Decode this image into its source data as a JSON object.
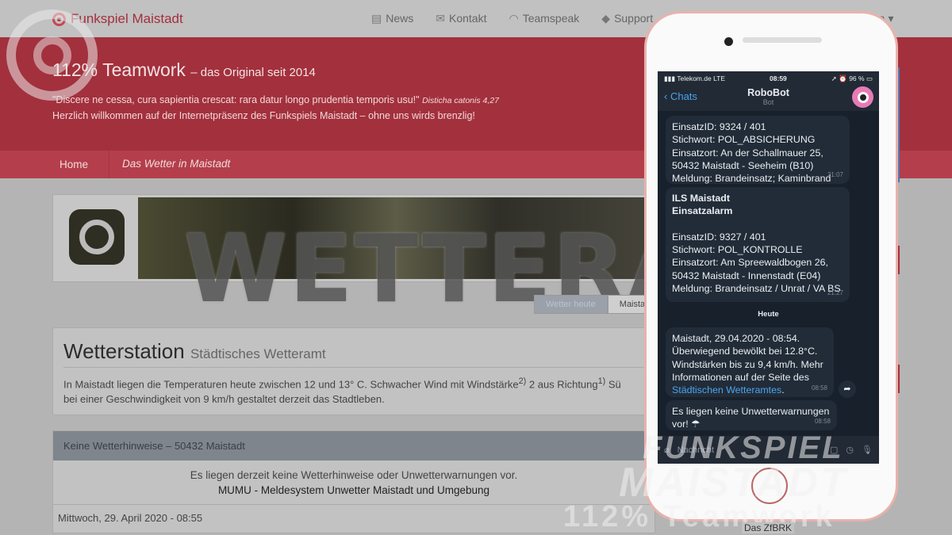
{
  "nav": {
    "brand": "Funkspiel Maistadt",
    "items": [
      {
        "icon": "newspaper-icon",
        "glyph": "▤",
        "label": "News"
      },
      {
        "icon": "envelope-icon",
        "glyph": "✉",
        "label": "Kontakt"
      },
      {
        "icon": "headset-icon",
        "glyph": "◠",
        "label": "Teamspeak"
      },
      {
        "icon": "ticket-icon",
        "glyph": "◆",
        "label": "Support"
      }
    ],
    "more": "ea ▾"
  },
  "hero": {
    "title": "112% Teamwork",
    "subtitle": "– das Original seit 2014",
    "quote": "\"Discere ne cessa, cura sapientia crescat: rara datur longo prudentia temporis usu!\"",
    "quote_source": "Disticha catonis 4,27",
    "welcome": "Herzlich willkommen auf der Internetpräsenz des Funkspiels Maistadt – ohne uns wirds brenzlig!"
  },
  "breadcrumb": {
    "home": "Home",
    "current": "Das Wetter in Maistadt"
  },
  "banner": {
    "watermark": "WETTERAMT",
    "tabs": [
      "Wetter heute",
      "Maistadt"
    ]
  },
  "station": {
    "title": "Wetterstation",
    "subtitle": "Städtisches Wetteramt",
    "text1": "In Maistadt liegen die Temperaturen heute zwischen 12 und 13° C. Schwacher Wind mit Windstärke",
    "sup1": "2)",
    "text2": " 2 aus Richtung",
    "sup2": "1)",
    "text3": " Sü",
    "text4": "bei einer Geschwindigkeit von 9 km/h gestaltet derzeit das Stadtleben."
  },
  "warnings": {
    "header": "Keine Wetterhinweise – 50432 Maistadt",
    "line1": "Es liegen derzeit keine Wetterhinweise oder Unwetterwarnungen vor.",
    "line2": "MUMU - Meldesystem Unwetter Maistadt und Umgebung",
    "footer": "Mittwoch, 29. April 2020 - 08:55"
  },
  "sidebar": {
    "zfbrk": "Das ZfBRK"
  },
  "watermark": {
    "line1": "FUNKSPIEL",
    "line2": "MAISTADT",
    "line3": "112% Teamwork"
  },
  "phone": {
    "carrier": "▮▮▮ Telekom.de  LTE",
    "time": "08:59",
    "battery": "➚ ⏰ 96 % ▭",
    "back": "Chats",
    "chat_title": "RoboBot",
    "chat_subtitle": "Bot",
    "day_separator": "Heute",
    "input_placeholder": "Nachricht",
    "messages": [
      {
        "lines": [
          "EinsatzID: 9324 / 401",
          "Stichwort: POL_ABSICHERUNG",
          "Einsatzort: An der Schallmauer 25,",
          "50432 Maistadt - Seeheim (B10)",
          "Meldung: Brandeinsatz; Kaminbrand"
        ],
        "time": "21:07"
      },
      {
        "lines": [
          "ILS Maistadt",
          "Einsatzalarm",
          "",
          "EinsatzID: 9327 / 401",
          "Stichwort: POL_KONTROLLE",
          "Einsatzort: Am Spreewaldbogen 26,",
          "50432 Maistadt - Innenstadt (E04)",
          "Meldung: Brandeinsatz / Unrat / VA BS"
        ],
        "time": "21:27"
      },
      {
        "lines": [
          "Maistadt, 29.04.2020 - 08:54.",
          "Überwiegend bewölkt bei 12.8°C.",
          "Windstärken bis zu 9,4 km/h. Mehr",
          "Informationen auf der Seite des"
        ],
        "link": "Städtischen Wetteramtes",
        "after_link": ".",
        "time": "08:58"
      },
      {
        "lines": [
          "Es liegen keine Unwetterwarnungen",
          "vor! ☂"
        ],
        "time": "08:58"
      }
    ]
  }
}
